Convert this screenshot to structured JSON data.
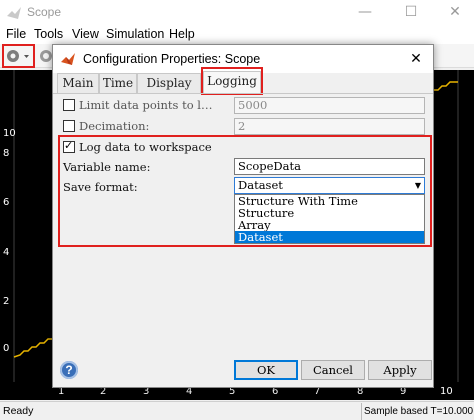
{
  "scope_window": {
    "title": "Scope",
    "window_buttons": {
      "minimize": "—",
      "maximize": "☐",
      "close": "✕"
    },
    "menu": [
      "File",
      "Tools",
      "View",
      "Simulation",
      "Help"
    ],
    "y_ticks": [
      "10",
      "8",
      "6",
      "4",
      "2",
      "0"
    ],
    "x_ticks": [
      "1",
      "2",
      "3",
      "4",
      "5",
      "6",
      "7",
      "8",
      "9",
      "10"
    ],
    "status": {
      "ready": "Ready",
      "sample": "Sample based  T=10.000"
    },
    "colors": {
      "plot_bg": "#000000",
      "trace": "#e8b400",
      "highlight": "#e0201e"
    }
  },
  "dialog": {
    "title": "Configuration Properties: Scope",
    "close_label": "✕",
    "tabs": [
      {
        "label": "Main",
        "active": false
      },
      {
        "label": "Time",
        "active": false
      },
      {
        "label": "Display",
        "active": false
      },
      {
        "label": "Logging",
        "active": true
      }
    ],
    "limit_points": {
      "label": "Limit data points to l…",
      "checked": false,
      "value": "5000"
    },
    "decimation": {
      "label": "Decimation:",
      "checked": false,
      "value": "2"
    },
    "log_to_workspace": {
      "label": "Log data to workspace",
      "checked": true
    },
    "variable_name": {
      "label": "Variable name:",
      "value": "ScopeData"
    },
    "save_format": {
      "label": "Save format:",
      "selected": "Dataset",
      "options": [
        "Structure With Time",
        "Structure",
        "Array",
        "Dataset"
      ]
    },
    "buttons": {
      "help": "?",
      "ok": "OK",
      "cancel": "Cancel",
      "apply": "Apply"
    }
  }
}
